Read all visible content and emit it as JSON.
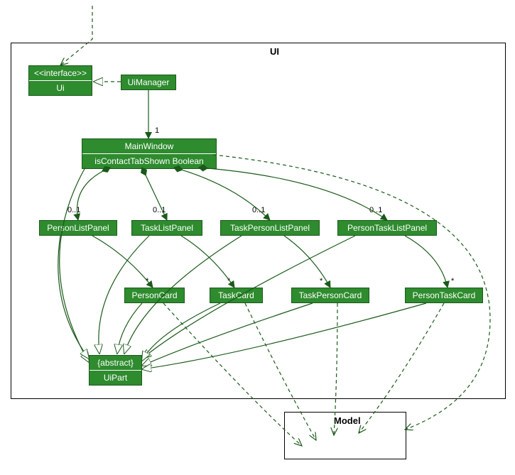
{
  "packages": {
    "ui_label": "UI",
    "model_label": "Model"
  },
  "classes": {
    "ui_interface": {
      "stereotype": "<<interface>>",
      "name": "Ui"
    },
    "ui_manager": {
      "name": "UiManager"
    },
    "main_window": {
      "name": "MainWindow",
      "attr": "isContactTabShown Boolean"
    },
    "person_list_panel": {
      "name": "PersonListPanel"
    },
    "task_list_panel": {
      "name": "TaskListPanel"
    },
    "task_person_list_panel": {
      "name": "TaskPersonListPanel"
    },
    "person_task_list_panel": {
      "name": "PersonTaskListPanel"
    },
    "person_card": {
      "name": "PersonCard"
    },
    "task_card": {
      "name": "TaskCard"
    },
    "task_person_card": {
      "name": "TaskPersonCard"
    },
    "person_task_card": {
      "name": "PersonTaskCard"
    },
    "ui_part": {
      "stereotype": "{abstract}",
      "name": "UiPart"
    }
  },
  "multiplicities": {
    "one": "1",
    "zero_one": "0..1",
    "many": "*"
  },
  "chart_data": {
    "type": "uml_class_diagram",
    "packages": [
      {
        "name": "UI",
        "contains": [
          "Ui",
          "UiManager",
          "MainWindow",
          "PersonListPanel",
          "TaskListPanel",
          "TaskPersonListPanel",
          "PersonTaskListPanel",
          "PersonCard",
          "TaskCard",
          "TaskPersonCard",
          "PersonTaskCard",
          "UiPart"
        ]
      },
      {
        "name": "Model",
        "contains": []
      }
    ],
    "classes": [
      {
        "name": "Ui",
        "stereotype": "interface"
      },
      {
        "name": "UiManager"
      },
      {
        "name": "MainWindow",
        "attributes": [
          "isContactTabShown Boolean"
        ]
      },
      {
        "name": "PersonListPanel"
      },
      {
        "name": "TaskListPanel"
      },
      {
        "name": "TaskPersonListPanel"
      },
      {
        "name": "PersonTaskListPanel"
      },
      {
        "name": "PersonCard"
      },
      {
        "name": "TaskCard"
      },
      {
        "name": "TaskPersonCard"
      },
      {
        "name": "PersonTaskCard"
      },
      {
        "name": "UiPart",
        "stereotype": "abstract"
      }
    ],
    "relationships": [
      {
        "from": "external",
        "to": "Ui",
        "type": "dependency"
      },
      {
        "from": "UiManager",
        "to": "Ui",
        "type": "realization"
      },
      {
        "from": "UiManager",
        "to": "MainWindow",
        "type": "association",
        "multiplicity": "1"
      },
      {
        "from": "MainWindow",
        "to": "PersonListPanel",
        "type": "composition",
        "multiplicity": "0..1"
      },
      {
        "from": "MainWindow",
        "to": "TaskListPanel",
        "type": "composition",
        "multiplicity": "0..1"
      },
      {
        "from": "MainWindow",
        "to": "TaskPersonListPanel",
        "type": "composition",
        "multiplicity": "0..1"
      },
      {
        "from": "MainWindow",
        "to": "PersonTaskListPanel",
        "type": "composition",
        "multiplicity": "0..1"
      },
      {
        "from": "PersonListPanel",
        "to": "PersonCard",
        "type": "association",
        "multiplicity": "*"
      },
      {
        "from": "TaskListPanel",
        "to": "TaskCard",
        "type": "association",
        "multiplicity": "*"
      },
      {
        "from": "TaskPersonListPanel",
        "to": "TaskPersonCard",
        "type": "association",
        "multiplicity": "*"
      },
      {
        "from": "PersonTaskListPanel",
        "to": "PersonTaskCard",
        "type": "association",
        "multiplicity": "*"
      },
      {
        "from": "MainWindow",
        "to": "UiPart",
        "type": "generalization"
      },
      {
        "from": "PersonListPanel",
        "to": "UiPart",
        "type": "generalization"
      },
      {
        "from": "TaskListPanel",
        "to": "UiPart",
        "type": "generalization"
      },
      {
        "from": "TaskPersonListPanel",
        "to": "UiPart",
        "type": "generalization"
      },
      {
        "from": "PersonTaskListPanel",
        "to": "UiPart",
        "type": "generalization"
      },
      {
        "from": "PersonCard",
        "to": "UiPart",
        "type": "generalization"
      },
      {
        "from": "TaskCard",
        "to": "UiPart",
        "type": "generalization"
      },
      {
        "from": "TaskPersonCard",
        "to": "UiPart",
        "type": "generalization"
      },
      {
        "from": "PersonTaskCard",
        "to": "UiPart",
        "type": "generalization"
      },
      {
        "from": "MainWindow",
        "to": "Model",
        "type": "dependency"
      },
      {
        "from": "PersonCard",
        "to": "Model",
        "type": "dependency"
      },
      {
        "from": "TaskCard",
        "to": "Model",
        "type": "dependency"
      },
      {
        "from": "TaskPersonCard",
        "to": "Model",
        "type": "dependency"
      },
      {
        "from": "PersonTaskCard",
        "to": "Model",
        "type": "dependency"
      }
    ]
  }
}
